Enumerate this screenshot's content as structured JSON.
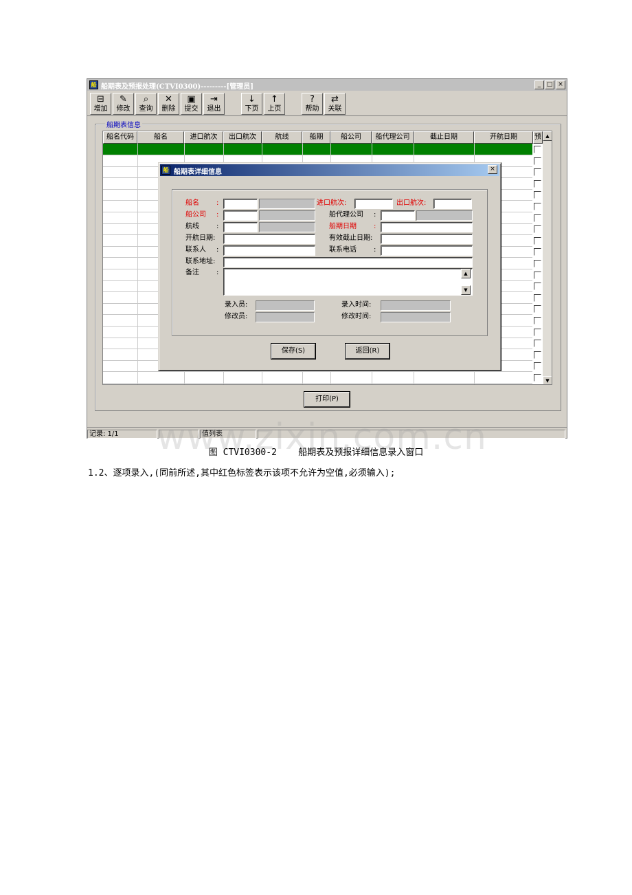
{
  "window": {
    "title": "船期表及预报处理(CTVI0300)---------[管理员]",
    "icon_text": "船",
    "controls": [
      "_",
      "□",
      "×"
    ]
  },
  "toolbar": [
    {
      "label": "增加",
      "icon": "add-icon",
      "glyph": "⊟"
    },
    {
      "label": "修改",
      "icon": "pencil-icon",
      "glyph": "✎"
    },
    {
      "label": "查询",
      "icon": "binoculars-icon",
      "glyph": "⌕"
    },
    {
      "label": "删除",
      "icon": "delete-x-icon",
      "glyph": "✕"
    },
    {
      "label": "提交",
      "icon": "floppy-disk-icon",
      "glyph": "▣"
    },
    {
      "label": "退出",
      "icon": "exit-door-icon",
      "glyph": "⇥"
    },
    {
      "label": "下页",
      "icon": "arrow-down-icon",
      "glyph": "↓"
    },
    {
      "label": "上页",
      "icon": "arrow-up-icon",
      "glyph": "↑"
    },
    {
      "label": "帮助",
      "icon": "help-icon",
      "glyph": "?"
    },
    {
      "label": "关联",
      "icon": "link-icon",
      "glyph": "⇄"
    }
  ],
  "group_label": "船期表信息",
  "grid": {
    "columns": [
      "船名代码",
      "船名",
      "进口航次",
      "出口航次",
      "航线",
      "船期",
      "船公司",
      "船代理公司",
      "截止日期",
      "开航日期",
      "预"
    ]
  },
  "print_label": "打印(P)",
  "status": {
    "records": "记录: 1/1",
    "blank": "",
    "table": "值列表",
    "extra": ""
  },
  "dialog": {
    "title": "船期表详细信息",
    "close": "×",
    "fields": {
      "ship_name": "船名",
      "import_voyage": "进口航次:",
      "export_voyage": "出口航次:",
      "ship_company": "船公司",
      "agent_company": "船代理公司",
      "route": "航线",
      "ship_date": "船期日期",
      "sailing_date": "开航日期:",
      "valid_deadline": "有效截止日期:",
      "contact": "联系人",
      "phone": "联系电话",
      "address": "联系地址:",
      "remark": "备注",
      "entered_by": "录入员:",
      "entered_time": "录入时间:",
      "modified_by": "修改员:",
      "modified_time": "修改时间:"
    },
    "colon": ":",
    "save_label": "保存(S)",
    "back_label": "返回(R)"
  },
  "caption": "图 CTVI0300-2    船期表及预报详细信息录入窗口",
  "paragraph": "1.2、逐项录入,(同前所述,其中红色标签表示该项不允许为空值,必须输入);",
  "watermark": "www.zixin.com.cn"
}
